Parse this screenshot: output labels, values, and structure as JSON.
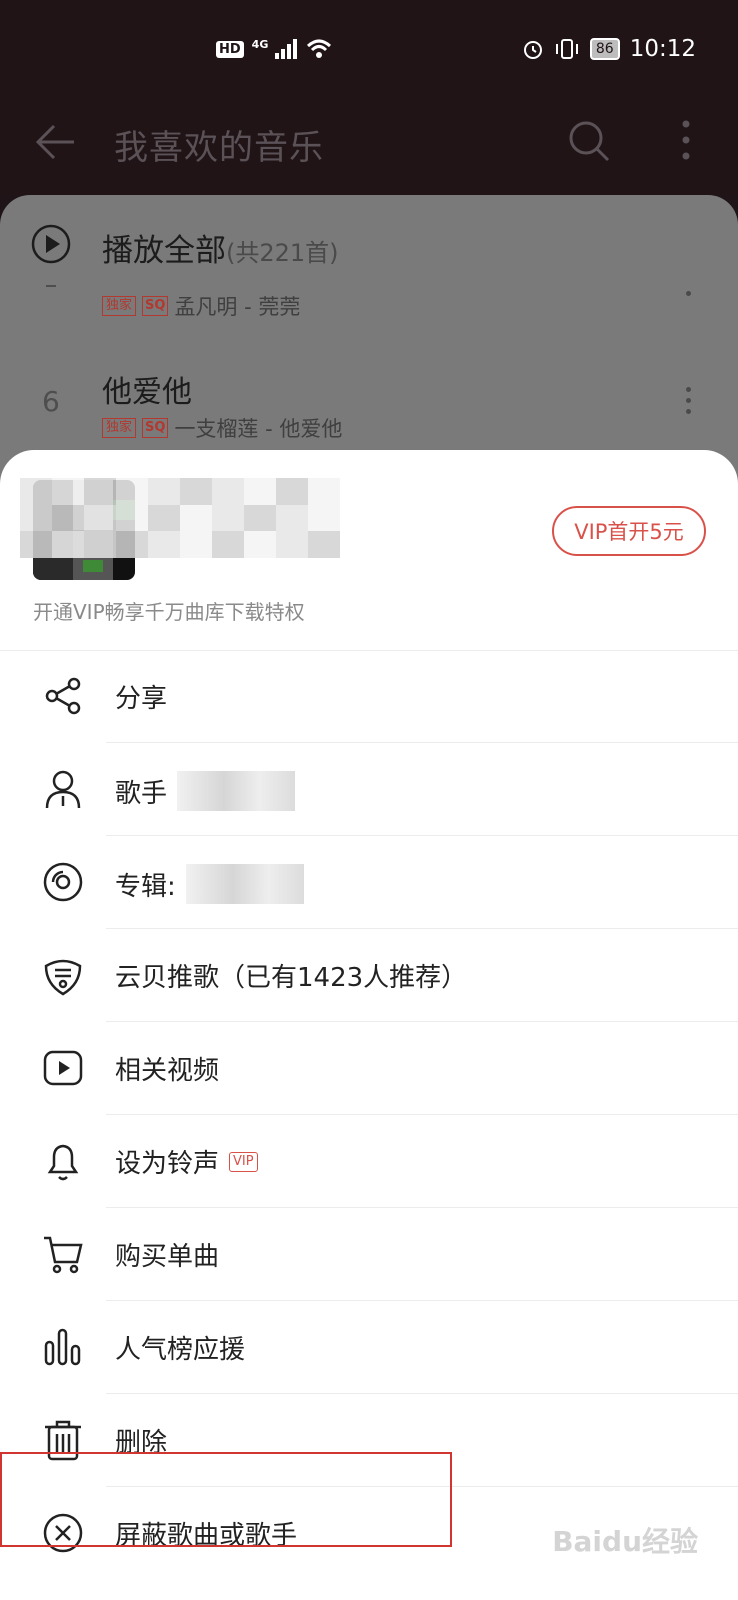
{
  "status_bar": {
    "hd": "HD",
    "network": "4G",
    "battery": "86",
    "time": "10:12"
  },
  "header": {
    "title": "我喜欢的音乐"
  },
  "playlist": {
    "play_all_label": "播放全部",
    "play_all_count": "(共221首)",
    "songs": [
      {
        "tag1": "独家",
        "tag2": "SQ",
        "artist_song": "孟凡明 - 莞莞"
      },
      {
        "index": "6",
        "title": "他爱他",
        "tag1": "独家",
        "tag2": "SQ",
        "artist_song": "一支榴莲 - 他爱他"
      }
    ]
  },
  "sheet": {
    "vip_button": "VIP首开5元",
    "vip_note": "开通VIP畅享千万曲库下载特权",
    "menu": [
      {
        "icon": "share-icon",
        "label": "分享"
      },
      {
        "icon": "singer-icon",
        "label": "歌手"
      },
      {
        "icon": "album-icon",
        "label": "专辑:"
      },
      {
        "icon": "recommend-icon",
        "label": "云贝推歌（已有1423人推荐）"
      },
      {
        "icon": "video-icon",
        "label": "相关视频"
      },
      {
        "icon": "bell-icon",
        "label": "设为铃声",
        "badge": "VIP"
      },
      {
        "icon": "cart-icon",
        "label": "购买单曲"
      },
      {
        "icon": "chart-icon",
        "label": "人气榜应援"
      },
      {
        "icon": "trash-icon",
        "label": "删除"
      },
      {
        "icon": "block-icon",
        "label": "屏蔽歌曲或歌手"
      }
    ]
  },
  "watermark": "Baidu经验",
  "colors": {
    "accent": "#d9524a",
    "highlight_border": "#d0352f",
    "dim_background": "#201417"
  }
}
